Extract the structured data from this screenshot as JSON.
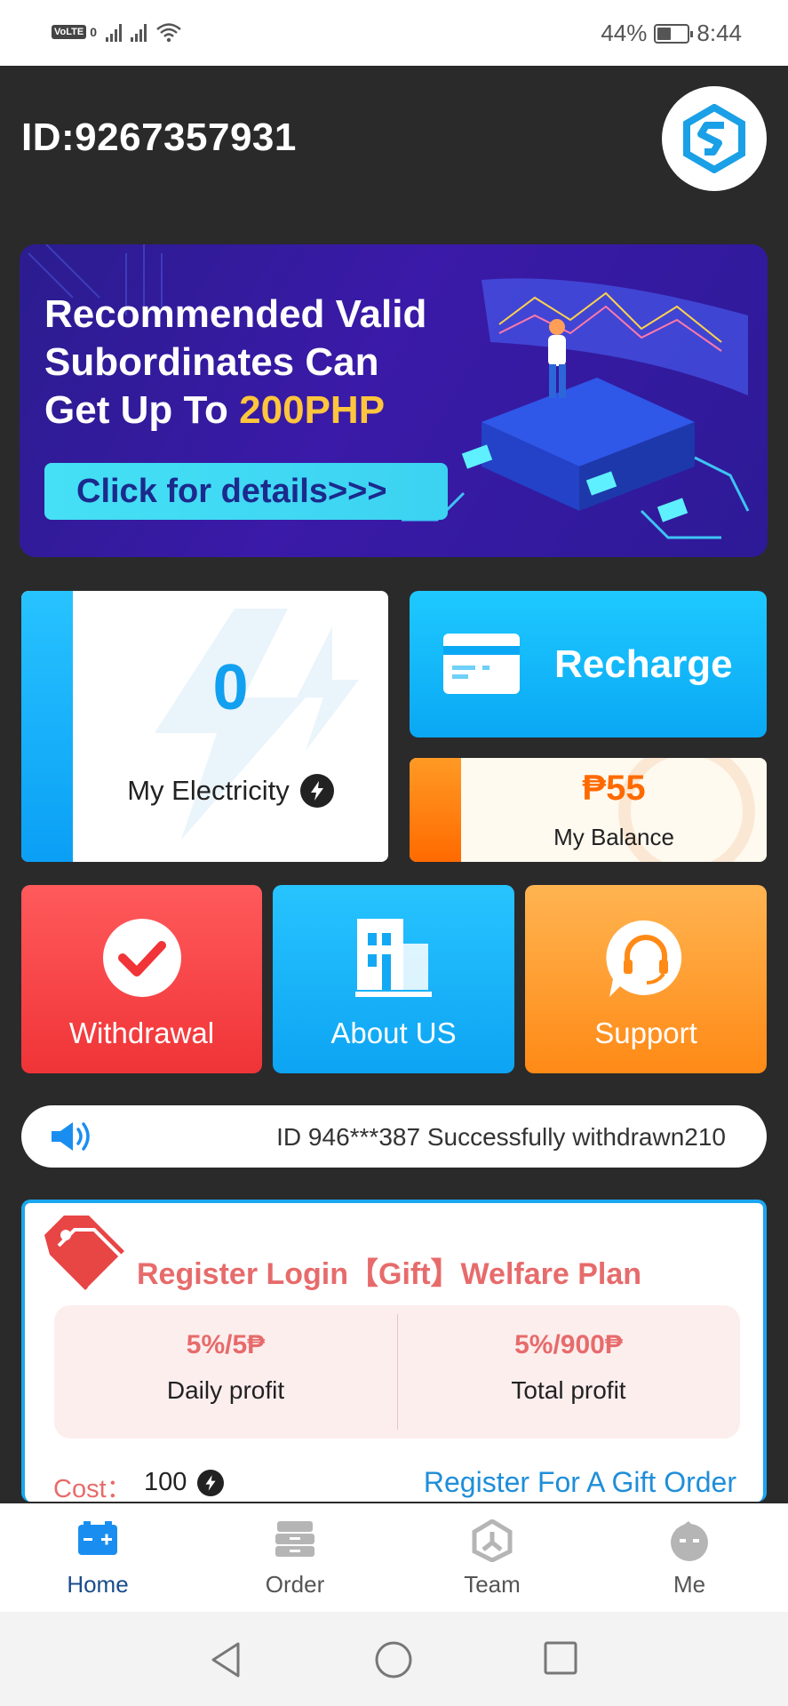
{
  "status_bar": {
    "volte": "VoLTE",
    "volte_suffix": "0",
    "battery": "44%",
    "time": "8:44"
  },
  "header": {
    "user_id": "ID:9267357931",
    "logo_icon": "app-logo-icon"
  },
  "banner": {
    "line1": "Recommended Valid",
    "line2": "Subordinates Can",
    "line3_prefix": "Get Up To ",
    "line3_highlight": "200PHP",
    "button": "Click for details>>>"
  },
  "electricity": {
    "value": "0",
    "label": "My Electricity"
  },
  "recharge": {
    "label": "Recharge"
  },
  "balance": {
    "value": "₱55",
    "label": "My Balance"
  },
  "tiles": {
    "withdrawal": "Withdrawal",
    "about": "About US",
    "support": "Support"
  },
  "notice": {
    "text": "ID 946***387 Successfully withdrawn210"
  },
  "welfare": {
    "title": "Register Login【Gift】Welfare Plan",
    "daily_value": "5%/5₱",
    "daily_label": "Daily profit",
    "total_value": "5%/900₱",
    "total_label": "Total profit",
    "cost_label": "Cost：",
    "cost_value": "100",
    "register_link": "Register For A Gift Order"
  },
  "bottom_nav": {
    "home": "Home",
    "order": "Order",
    "team": "Team",
    "me": "Me"
  },
  "colors": {
    "accent_blue": "#0da4f3",
    "accent_orange": "#ff6a00",
    "accent_red": "#f03437",
    "welfare_pink": "#e76b6b"
  }
}
